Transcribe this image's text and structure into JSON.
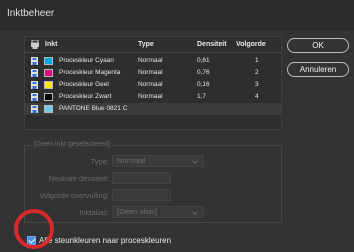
{
  "window": {
    "title": "Inktbeheer"
  },
  "table": {
    "headers": {
      "name": "Inkt",
      "type": "Type",
      "density": "Densiteit",
      "order": "Volgorde"
    },
    "rows": [
      {
        "name": "Proceskleur Cyaan",
        "type": "Normaal",
        "density": "0,61",
        "order": "1",
        "swatch": "#00a6e8"
      },
      {
        "name": "Proceskleur Magenta",
        "type": "Normaal",
        "density": "0,76",
        "order": "2",
        "swatch": "#e4007f"
      },
      {
        "name": "Proceskleur Geel",
        "type": "Normaal",
        "density": "0,16",
        "order": "3",
        "swatch": "#ffe900"
      },
      {
        "name": "Proceskleur Zwart",
        "type": "Normaal",
        "density": "1,7",
        "order": "4",
        "swatch": "#000000"
      },
      {
        "name": "PANTONE Blue 0821 C",
        "type": "",
        "density": "",
        "order": "",
        "swatch": "#6fcde8"
      }
    ]
  },
  "buttons": {
    "ok": "OK",
    "cancel": "Annuleren"
  },
  "details": {
    "group_title": "[Geen inkt geselecteerd]",
    "type_label": "Type:",
    "type_value": "Normaal",
    "density_label": "Neutrale densiteit:",
    "trap_label": "Volgorde overvulling:",
    "alias_label": "Inktalias:",
    "alias_value": "[Geen alias]"
  },
  "option": {
    "label": "Alle steunkleuren naar proceskleuren",
    "checked": true
  },
  "colors": {
    "accent": "#4a90e2",
    "highlight": "#d62b2b",
    "background": "#333333"
  }
}
